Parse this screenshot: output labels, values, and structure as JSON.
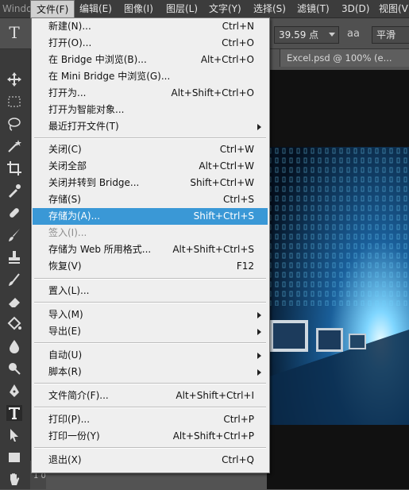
{
  "window": {
    "title_fragment": "Windo"
  },
  "menubar": {
    "items": [
      {
        "label": "文件(F)",
        "active": true
      },
      {
        "label": "编辑(E)"
      },
      {
        "label": "图像(I)"
      },
      {
        "label": "图层(L)"
      },
      {
        "label": "文字(Y)"
      },
      {
        "label": "选择(S)"
      },
      {
        "label": "滤镜(T)"
      },
      {
        "label": "3D(D)"
      },
      {
        "label": "视图(V)"
      }
    ]
  },
  "options": {
    "font_size_value": "39.59 点",
    "aa_icon": "aa",
    "aa_mode_value": "平滑"
  },
  "document": {
    "tab_title": "Excel.psd @ 100% (e...",
    "ruler_mark": "1 0"
  },
  "file_menu": {
    "items": [
      {
        "label": "新建(N)...",
        "shortcut": "Ctrl+N"
      },
      {
        "label": "打开(O)...",
        "shortcut": "Ctrl+O"
      },
      {
        "label": "在 Bridge 中浏览(B)...",
        "shortcut": "Alt+Ctrl+O"
      },
      {
        "label": "在 Mini Bridge 中浏览(G)...",
        "shortcut": ""
      },
      {
        "label": "打开为...",
        "shortcut": "Alt+Shift+Ctrl+O"
      },
      {
        "label": "打开为智能对象...",
        "shortcut": ""
      },
      {
        "label": "最近打开文件(T)",
        "shortcut": "",
        "submenu": true
      },
      {
        "label": "关闭(C)",
        "shortcut": "Ctrl+W"
      },
      {
        "label": "关闭全部",
        "shortcut": "Alt+Ctrl+W"
      },
      {
        "label": "关闭并转到 Bridge...",
        "shortcut": "Shift+Ctrl+W"
      },
      {
        "label": "存储(S)",
        "shortcut": "Ctrl+S"
      },
      {
        "label": "存储为(A)...",
        "shortcut": "Shift+Ctrl+S",
        "highlighted": true
      },
      {
        "label": "签入(I)...",
        "shortcut": "",
        "disabled": true
      },
      {
        "label": "存储为 Web 所用格式...",
        "shortcut": "Alt+Shift+Ctrl+S"
      },
      {
        "label": "恢复(V)",
        "shortcut": "F12"
      },
      {
        "label": "置入(L)...",
        "shortcut": ""
      },
      {
        "label": "导入(M)",
        "shortcut": "",
        "submenu": true
      },
      {
        "label": "导出(E)",
        "shortcut": "",
        "submenu": true
      },
      {
        "label": "自动(U)",
        "shortcut": "",
        "submenu": true
      },
      {
        "label": "脚本(R)",
        "shortcut": "",
        "submenu": true
      },
      {
        "label": "文件简介(F)...",
        "shortcut": "Alt+Shift+Ctrl+I"
      },
      {
        "label": "打印(P)...",
        "shortcut": "Ctrl+P"
      },
      {
        "label": "打印一份(Y)",
        "shortcut": "Alt+Shift+Ctrl+P"
      },
      {
        "label": "退出(X)",
        "shortcut": "Ctrl+Q"
      }
    ]
  },
  "colors": {
    "highlight": "#3a98d6",
    "menu_bg": "#efefef",
    "workspace": "#535353"
  }
}
